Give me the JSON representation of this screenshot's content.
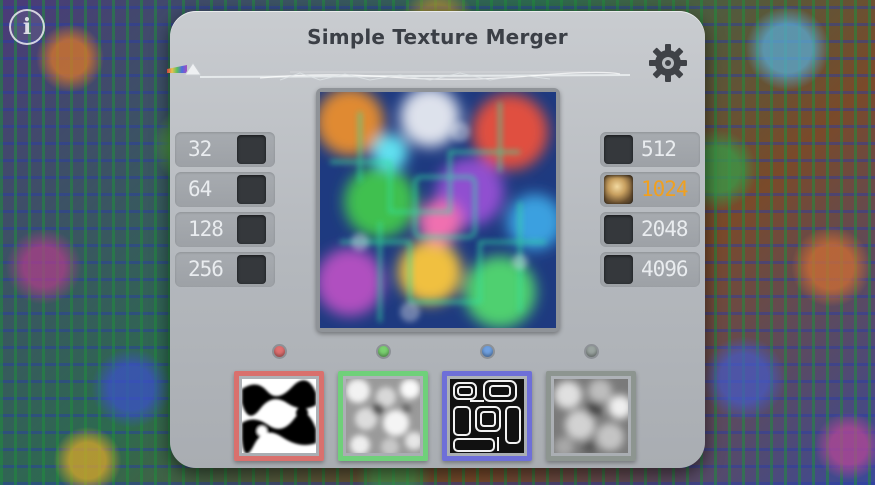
{
  "app": {
    "title": "Simple Texture Merger"
  },
  "resolutions": {
    "left": [
      {
        "label": "32",
        "selected": false
      },
      {
        "label": "64",
        "selected": false
      },
      {
        "label": "128",
        "selected": false
      },
      {
        "label": "256",
        "selected": false
      }
    ],
    "right": [
      {
        "label": "512",
        "selected": false
      },
      {
        "label": "1024",
        "selected": true
      },
      {
        "label": "2048",
        "selected": false
      },
      {
        "label": "4096",
        "selected": false
      }
    ]
  },
  "channels": [
    {
      "name": "red",
      "color": "#d9706d",
      "indicator": "#e07070"
    },
    {
      "name": "green",
      "color": "#6fd07a",
      "indicator": "#7ad070"
    },
    {
      "name": "blue",
      "color": "#6e6fd8",
      "indicator": "#6fa0e0"
    },
    {
      "name": "alpha",
      "color": "#8d9590",
      "indicator": "#9aa4a0"
    }
  ],
  "icons": {
    "info": "info-icon",
    "settings": "gear-icon",
    "logo": "prism-icon"
  },
  "colors": {
    "accent": "#f0a020",
    "panel": "#bfc3c7",
    "text": "#3b3f46"
  }
}
